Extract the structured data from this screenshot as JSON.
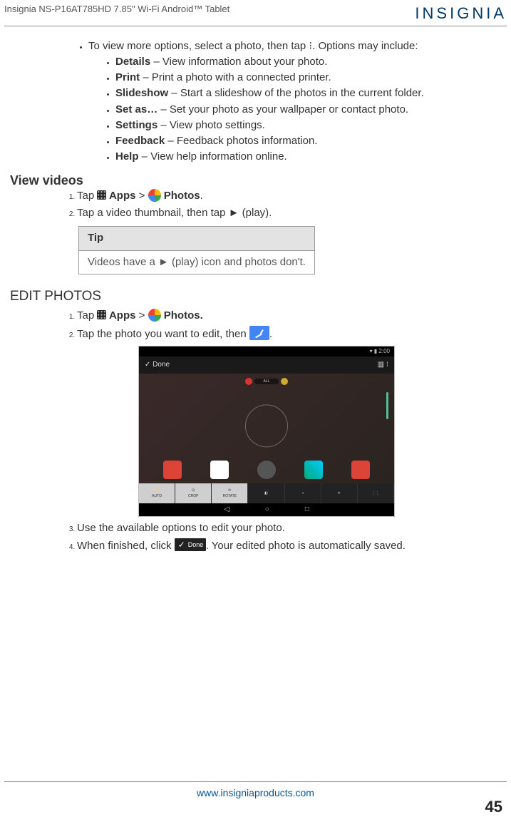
{
  "header": {
    "leftLine": "Insignia   NS-P16AT785HD   7.85\" Wi-Fi Android™ Tablet",
    "brand": "INSIGNIA"
  },
  "intro": {
    "line": "To view more options, select a photo, then tap  ⁝. Options may include:"
  },
  "options": [
    {
      "term": "Details",
      "desc": " – View information about your photo."
    },
    {
      "term": "Print",
      "desc": " – Print a photo with a connected printer."
    },
    {
      "term": "Slideshow",
      "desc": " – Start a slideshow of the photos in the current folder."
    },
    {
      "term": "Set as…",
      "desc": " – Set your photo as your wallpaper or contact photo."
    },
    {
      "term": "Settings",
      "desc": " – View photo settings."
    },
    {
      "term": "Feedback",
      "desc": " – Feedback photos information."
    },
    {
      "term": "Help",
      "desc": " – View help information online."
    }
  ],
  "viewVideos": {
    "heading": "View videos",
    "step1_pre": "Tap ",
    "step1_mid": " Apps",
    "step1_gt": " > ",
    "step1_post": " Photos",
    "step1_end": ".",
    "step2": "Tap a video thumbnail, then tap ► (play).",
    "tipLabel": "Tip",
    "tipBody": "Videos have a ► (play) icon and photos don't."
  },
  "editPhotos": {
    "heading": "EDIT PHOTOS",
    "step1_pre": "Tap ",
    "step1_mid": " Apps",
    "step1_gt": " > ",
    "step1_post": " Photos.",
    "step2_pre": "Tap the photo you want to edit, then ",
    "step2_post": ".",
    "step3": "Use the available options to edit your photo.",
    "step4_pre": "When finished, click ",
    "step4_post": ". Your edited photo is automatically saved."
  },
  "screenshot": {
    "statusTime": "▾ ▮ 2:00",
    "topbarLeft": "✓  Done",
    "topbarRight": "▥   ⁝",
    "editTabs": [
      "AUTO",
      "CROP",
      "ROTATE",
      "",
      "",
      "",
      ""
    ],
    "navBack": "◁",
    "navHome": "○",
    "navRecent": "□",
    "allLabel": "ALL"
  },
  "footer": {
    "url": "www.insigniaproducts.com",
    "page": "45"
  }
}
